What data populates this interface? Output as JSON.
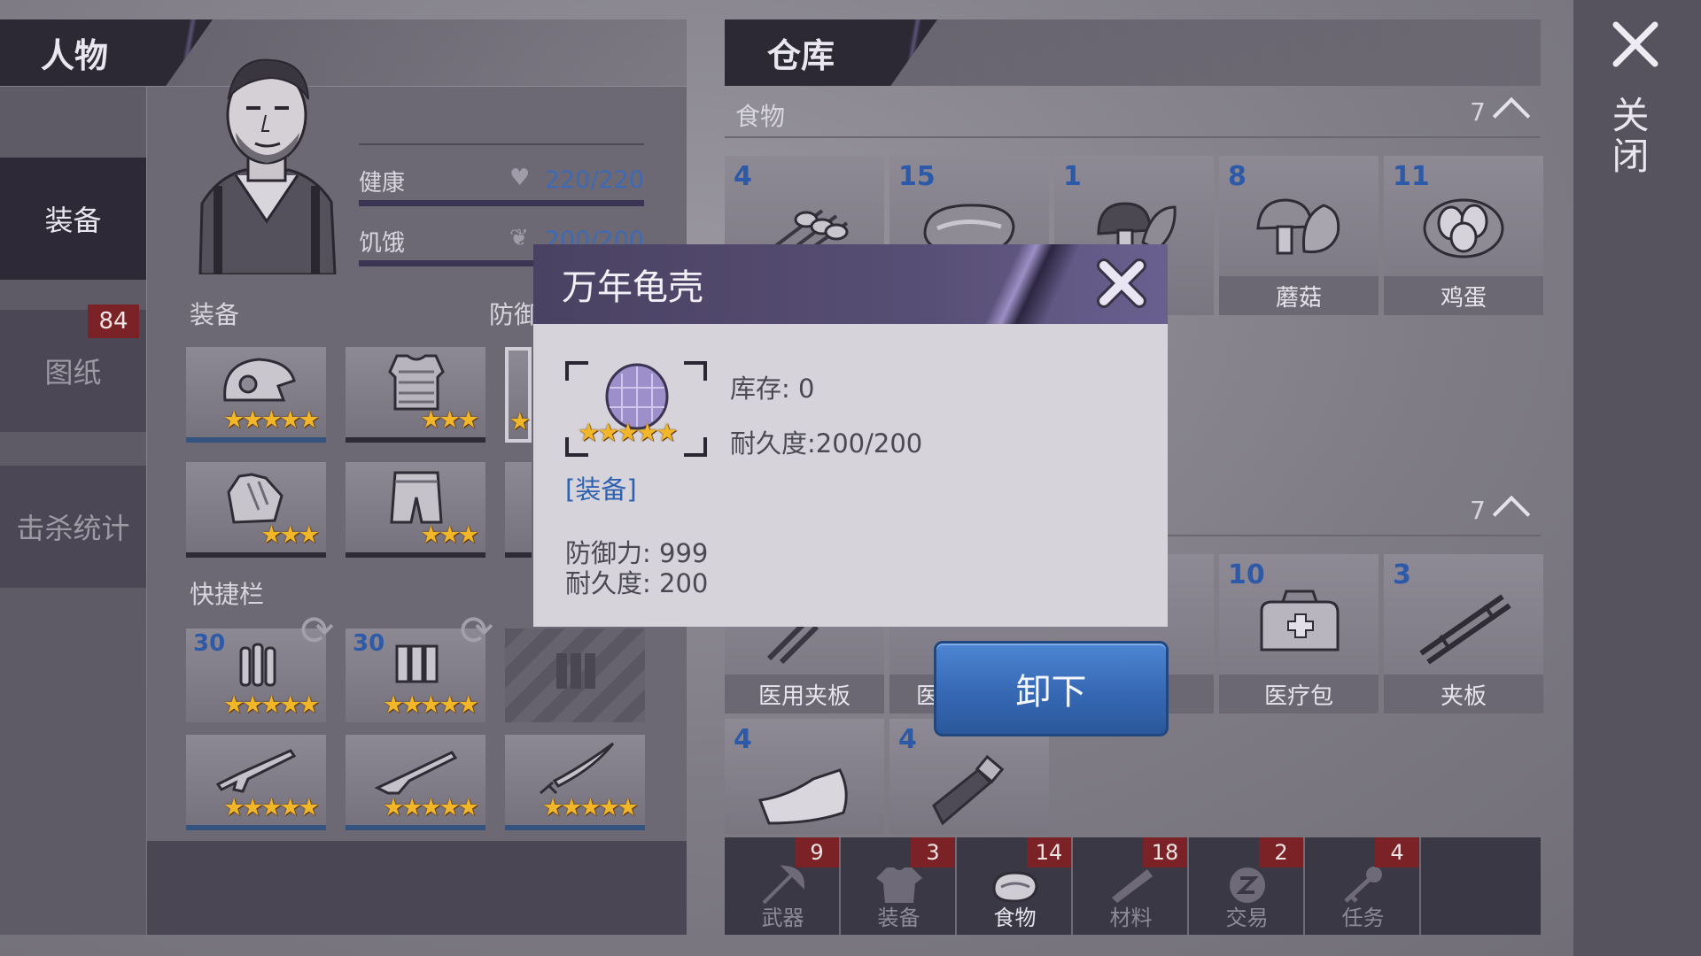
{
  "character": {
    "title": "人物",
    "nav": [
      {
        "label": "装备",
        "active": true
      },
      {
        "label": "图纸",
        "badge": "84"
      },
      {
        "label": "击杀统计"
      }
    ],
    "stats": [
      {
        "label": "健康",
        "value": "220/220",
        "icon": "heart-icon"
      },
      {
        "label": "饥饿",
        "value": "200/200",
        "icon": "stomach-icon"
      }
    ],
    "equipment_label": "装备",
    "defense_label": "防御",
    "quickbar_label": "快捷栏",
    "equipment_slots": [
      {
        "icon": "helmet-icon",
        "stars": "★★★★★"
      },
      {
        "icon": "body-armor-icon",
        "stars": "★★★"
      },
      {
        "icon": "shell-icon",
        "stars": "★"
      },
      {
        "icon": "gloves-icon",
        "stars": "★★★"
      },
      {
        "icon": "pants-icon",
        "stars": "★★★"
      },
      {
        "icon": "boots-icon",
        "stars": ""
      }
    ],
    "quickbar_slots": [
      {
        "icon": "rifle-ammo-icon",
        "qty": "30",
        "stars": "★★★★★"
      },
      {
        "icon": "shotgun-ammo-icon",
        "qty": "30",
        "stars": "★★★★★"
      },
      {
        "icon": "locked-ammo-icon",
        "locked": true
      },
      {
        "icon": "assault-rifle-icon",
        "stars": "★★★★★"
      },
      {
        "icon": "shotgun-icon",
        "stars": "★★★★★"
      },
      {
        "icon": "katana-icon",
        "stars": "★★★★★"
      }
    ]
  },
  "warehouse": {
    "title": "仓库",
    "food": {
      "label": "食物",
      "count": "7",
      "items": [
        {
          "qty": "4",
          "name": "",
          "icon": "skewer-icon"
        },
        {
          "qty": "15",
          "name": "",
          "icon": "meat-icon"
        },
        {
          "qty": "1",
          "name": "",
          "icon": "dark-mushroom-icon"
        },
        {
          "qty": "8",
          "name": "蘑菇",
          "icon": "mushroom-icon"
        },
        {
          "qty": "11",
          "name": "鸡蛋",
          "icon": "eggs-icon"
        }
      ]
    },
    "medical": {
      "label": "",
      "count": "7",
      "items": [
        {
          "qty": "",
          "name": "医用夹板",
          "icon": "medical-splint-icon"
        },
        {
          "qty": "",
          "name": "医",
          "icon": "medical-item-icon"
        },
        {
          "qty": "",
          "name": "",
          "icon": "medical-item-icon"
        },
        {
          "qty": "10",
          "name": "医疗包",
          "icon": "medkit-icon"
        },
        {
          "qty": "3",
          "name": "夹板",
          "icon": "splint-icon"
        },
        {
          "qty": "4",
          "name": "",
          "icon": "bandage-icon"
        },
        {
          "qty": "4",
          "name": "",
          "icon": "pill-bottle-icon"
        }
      ]
    },
    "tabs": [
      {
        "label": "武器",
        "badge": "9",
        "icon": "axe-icon"
      },
      {
        "label": "装备",
        "badge": "3",
        "icon": "shirt-icon"
      },
      {
        "label": "食物",
        "badge": "14",
        "icon": "meat-icon",
        "active": true
      },
      {
        "label": "材料",
        "badge": "18",
        "icon": "wood-icon"
      },
      {
        "label": "交易",
        "badge": "2",
        "icon": "coin-icon"
      },
      {
        "label": "任务",
        "badge": "4",
        "icon": "key-icon"
      }
    ]
  },
  "close": {
    "label": "关闭"
  },
  "popup": {
    "title": "万年龟壳",
    "stars": "★★★★★",
    "stock": "库存: 0",
    "durability": "耐久度:200/200",
    "tag": "[装备]",
    "defense": "防御力: 999",
    "durability_stat": "耐久度: 200",
    "action_label": "卸下"
  },
  "colors": {
    "accent_blue": "#3668b4",
    "badge_red": "#7a2226",
    "star_gold": "#f2b629",
    "panel_dark": "#2c2834"
  }
}
